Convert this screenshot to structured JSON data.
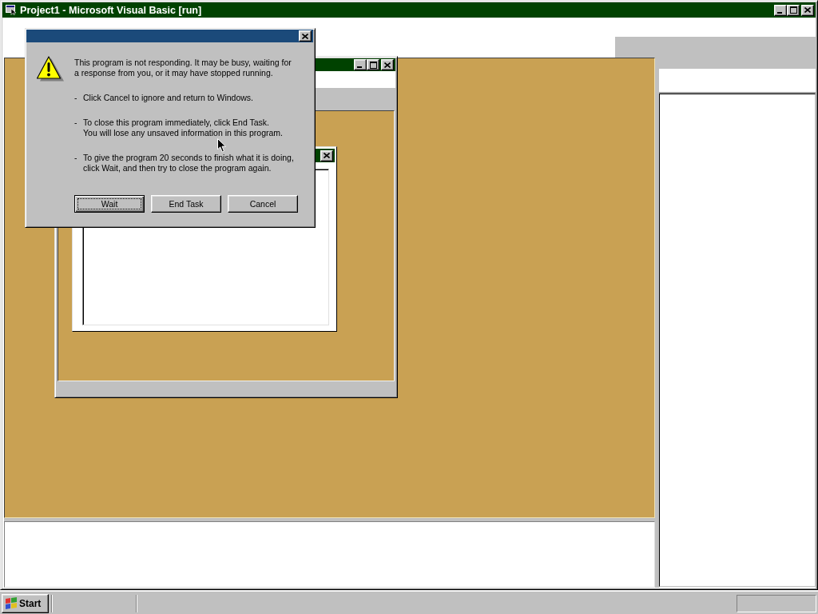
{
  "main_window": {
    "title": "Project1 - Microsoft Visual Basic [run]"
  },
  "dialog": {
    "message": "This program is not responding. It may be busy, waiting for\na response from you, or it may have stopped running.",
    "bullets": [
      {
        "marker": "-",
        "text": "Click Cancel to ignore and return to Windows."
      },
      {
        "marker": "-",
        "text": "To close this program immediately, click End Task.\nYou will lose any unsaved information in this program."
      },
      {
        "marker": "-",
        "text": "To give the program 20 seconds to finish what it is doing,\nclick Wait, and then try to close the program again."
      }
    ],
    "buttons": [
      {
        "label": "Wait",
        "default": true
      },
      {
        "label": "End Task",
        "default": false
      },
      {
        "label": "Cancel",
        "default": false
      }
    ]
  },
  "taskbar": {
    "start_button": {
      "label": "Start"
    }
  }
}
